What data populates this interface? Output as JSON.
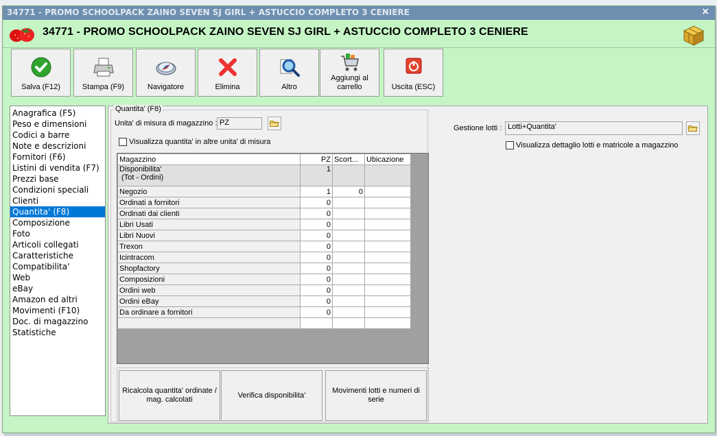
{
  "window": {
    "title": "34771 - PROMO SCHOOLPACK ZAINO SEVEN SJ GIRL + ASTUCCIO COMPLETO 3 CENIERE",
    "header_title": "34771 - PROMO SCHOOLPACK ZAINO SEVEN SJ GIRL + ASTUCCIO COMPLETO 3 CENIERE",
    "close_glyph": "×"
  },
  "toolbar": [
    {
      "id": "save",
      "label": "Salva (F12)",
      "icon": "check-icon"
    },
    {
      "id": "print",
      "label": "Stampa (F9)",
      "icon": "printer-icon"
    },
    {
      "id": "navigator",
      "label": "Navigatore",
      "icon": "compass-icon"
    },
    {
      "id": "delete",
      "label": "Elimina",
      "icon": "delete-x-icon"
    },
    {
      "id": "other",
      "label": "Altro",
      "icon": "magnifier-icon"
    },
    {
      "id": "cart",
      "label": "Aggiungi al carrello",
      "icon": "cart-icon"
    },
    {
      "id": "exit",
      "label": "Uscita (ESC)",
      "icon": "power-icon"
    }
  ],
  "nav": [
    "Anagrafica (F5)",
    "Peso e dimensioni",
    "Codici a barre",
    "Note e descrizioni",
    "Fornitori (F6)",
    "Listini di vendita (F7)",
    "Prezzi base",
    "Condizioni speciali",
    "Clienti",
    "Quantita' (F8)",
    "Composizione",
    "Foto",
    "Articoli collegati",
    "Caratteristiche",
    "Compatibilita'",
    "Web",
    "eBay",
    "Amazon ed altri",
    "Movimenti (F10)",
    "Doc. di magazzino",
    "Statistiche"
  ],
  "nav_selected_index": 9,
  "quantita": {
    "group_title": "Quantita' (F8)",
    "unit_label": "Unita' di misura di magazzino :",
    "unit_value": "PZ",
    "show_other_units_label": "Visualizza quantita' in altre unita' di misura",
    "lots_label": "Gestione lotti :",
    "lots_value": "Lotti+Quantita'",
    "show_lots_detail_label": "Visualizza dettaglio lotti e matricole a magazzino",
    "columns": [
      "Magazzino",
      "PZ",
      "Scort...",
      "Ubicazione"
    ],
    "rows": [
      {
        "name": "Disponibilita'",
        "name2": " (Tot - Ordini)",
        "pz": "1",
        "scorta": "",
        "ubicazione": "",
        "tall": true
      },
      {
        "name": "Negozio",
        "pz": "1",
        "scorta": "0",
        "ubicazione": ""
      },
      {
        "name": "Ordinati a fornitori",
        "pz": "0",
        "scorta": "",
        "ubicazione": ""
      },
      {
        "name": "Ordinati dai clienti",
        "pz": "0",
        "scorta": "",
        "ubicazione": ""
      },
      {
        "name": "Libri Usati",
        "pz": "0",
        "scorta": "",
        "ubicazione": ""
      },
      {
        "name": "Libri Nuovi",
        "pz": "0",
        "scorta": "",
        "ubicazione": ""
      },
      {
        "name": "Trexon",
        "pz": "0",
        "scorta": "",
        "ubicazione": ""
      },
      {
        "name": "Icintracom",
        "pz": "0",
        "scorta": "",
        "ubicazione": ""
      },
      {
        "name": "Shopfactory",
        "pz": "0",
        "scorta": "",
        "ubicazione": ""
      },
      {
        "name": "Composizioni",
        "pz": "0",
        "scorta": "",
        "ubicazione": ""
      },
      {
        "name": "Ordini web",
        "pz": "0",
        "scorta": "",
        "ubicazione": ""
      },
      {
        "name": "Ordini eBay",
        "pz": "0",
        "scorta": "",
        "ubicazione": ""
      },
      {
        "name": "Da ordinare a fornitori",
        "pz": "0",
        "scorta": "",
        "ubicazione": ""
      },
      {
        "name": "",
        "pz": "",
        "scorta": "",
        "ubicazione": ""
      }
    ],
    "buttons": [
      "Ricalcola quantita' ordinate / mag. calcolati",
      "Verifica disponibilita'",
      "Movimenti lotti e numeri di serie"
    ]
  },
  "colors": {
    "window_bg": "#c5f5c5",
    "titlebar": "#6e8fb0",
    "selection": "#0078d7"
  }
}
